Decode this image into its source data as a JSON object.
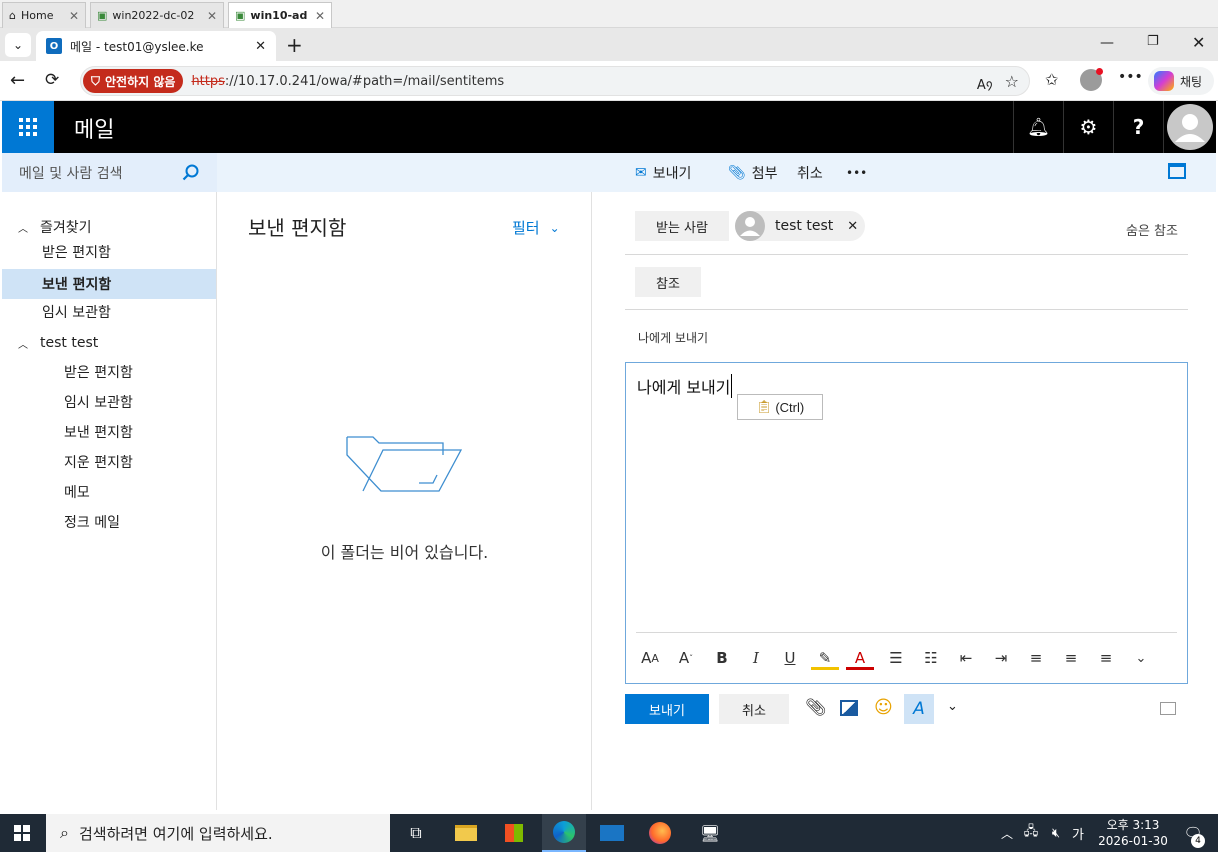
{
  "vm_tabs": [
    {
      "label": "Home"
    },
    {
      "label": "win2022-dc-02"
    },
    {
      "label": "win10-ad"
    }
  ],
  "browser": {
    "tab_title": "메일 - test01@yslee.ke",
    "unsafe_label": "안전하지 않음",
    "url_scheme": "https",
    "url_rest": "://10.17.0.241/owa/#path=/mail/sentitems",
    "chat_label": "채팅"
  },
  "owa": {
    "app_title": "메일",
    "search_placeholder": "메일 및 사람 검색",
    "toolbar": {
      "send": "보내기",
      "attach": "첨부",
      "cancel": "취소",
      "more": "•••"
    },
    "nav": {
      "favorites_header": "즐겨찾기",
      "favorites": [
        "받은 편지함",
        "보낸 편지함",
        "임시 보관함"
      ],
      "account_header": "test test",
      "account_folders": [
        "받은 편지함",
        "임시 보관함",
        "보낸 편지함",
        "지운 편지함",
        "메모",
        "정크 메일"
      ]
    },
    "list": {
      "title": "보낸 편지함",
      "filter": "필터",
      "empty_message": "이 폴더는 비어 있습니다."
    },
    "compose": {
      "to_button": "받는 사람",
      "recipient": "test test",
      "bcc_link": "숨은 참조",
      "cc_button": "참조",
      "subject": "나에게 보내기",
      "body": "나에게 보내기",
      "paste_option": "(Ctrl)",
      "send_button": "보내기",
      "cancel_button": "취소"
    }
  },
  "taskbar": {
    "search_placeholder": "검색하려면 여기에 입력하세요.",
    "ime": "가",
    "time": "오후 3:13",
    "date": "2026-01-30",
    "notifications": "4"
  },
  "colors": {
    "accent": "#0078d4",
    "unsafe": "#c42b1c",
    "selected": "#cfe3f6"
  }
}
